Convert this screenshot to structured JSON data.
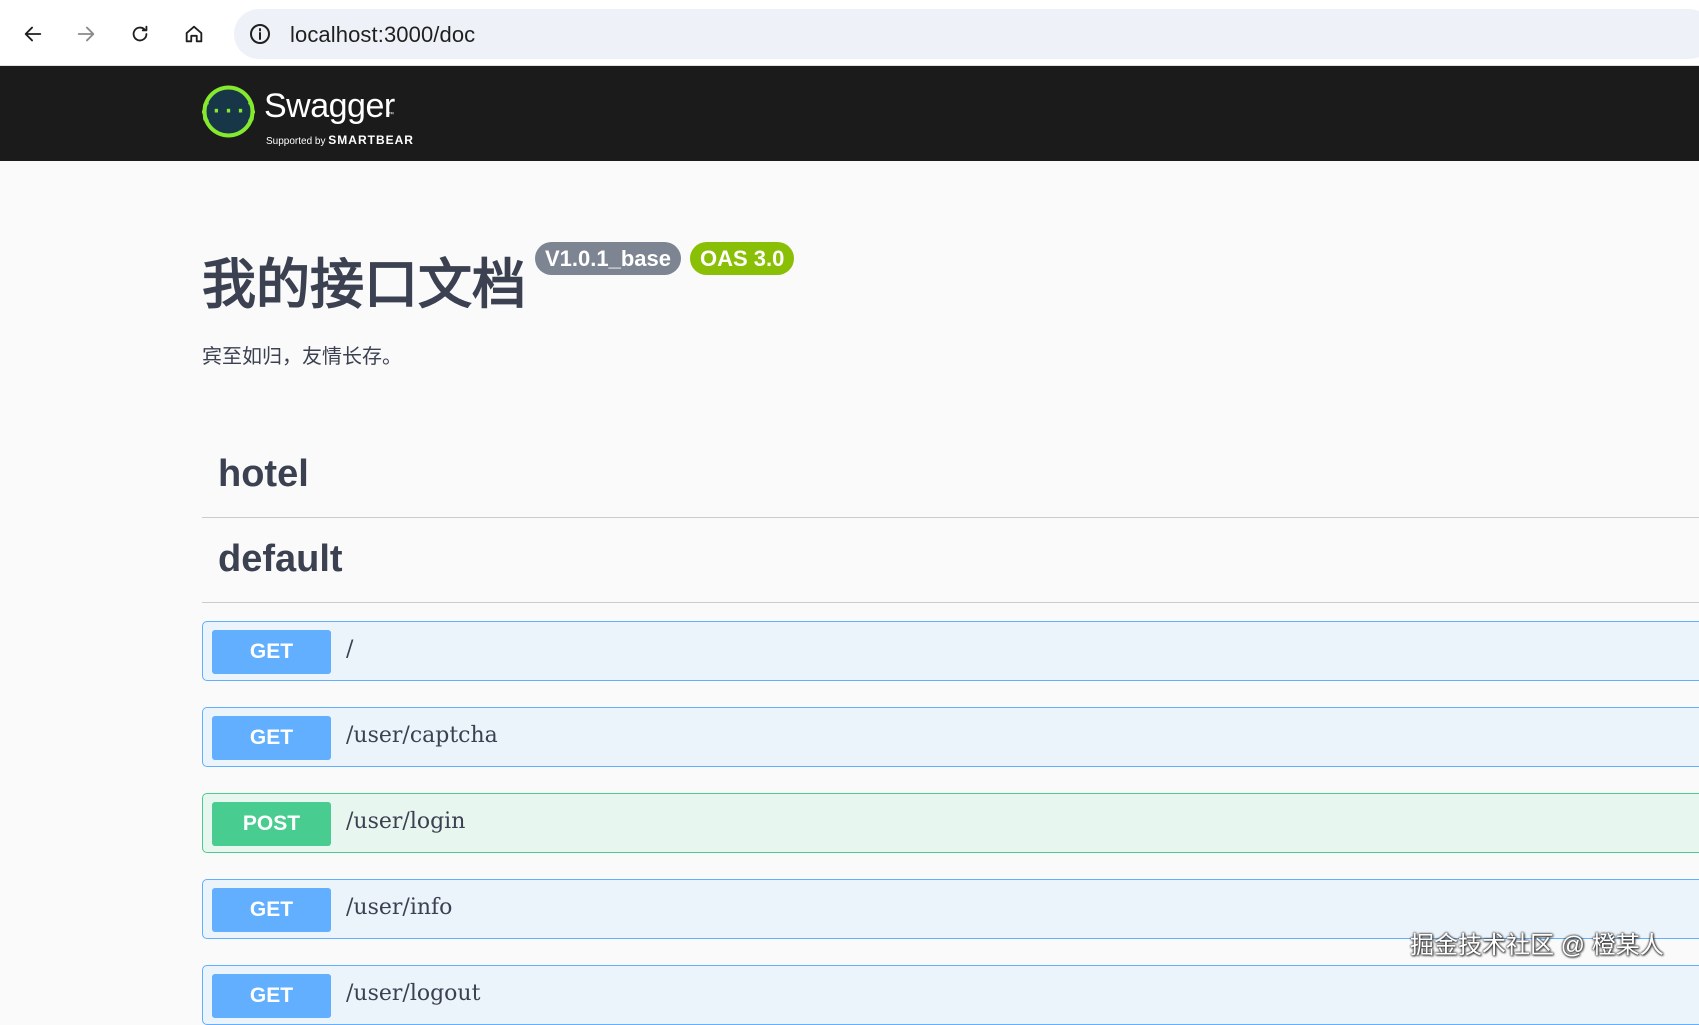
{
  "browser": {
    "url": "localhost:3000/doc",
    "icons": [
      "back-arrow-icon",
      "forward-arrow-icon",
      "reload-icon",
      "home-icon",
      "info-icon"
    ]
  },
  "topbar": {
    "logo_text": "Swagger",
    "logo_tm": "™",
    "logo_sub_prefix": "Supported by",
    "logo_sub_brand": "SMARTBEAR",
    "brand_color": "#85ea2d",
    "background": "#1b1b1b"
  },
  "info": {
    "title": "我的接口文档",
    "version_badge": "V1.0.1_base",
    "oas_badge": "OAS 3.0",
    "description": "宾至如归，友情长存。"
  },
  "tags": [
    {
      "name": "hotel"
    },
    {
      "name": "default"
    }
  ],
  "operations": [
    {
      "method": "GET",
      "path": "/"
    },
    {
      "method": "GET",
      "path": "/user/captcha"
    },
    {
      "method": "POST",
      "path": "/user/login"
    },
    {
      "method": "GET",
      "path": "/user/info"
    },
    {
      "method": "GET",
      "path": "/user/logout"
    }
  ],
  "colors": {
    "get": "#61affe",
    "post": "#49cc90",
    "text": "#3b4151"
  },
  "watermark": "掘金技术社区 @ 橙某人"
}
